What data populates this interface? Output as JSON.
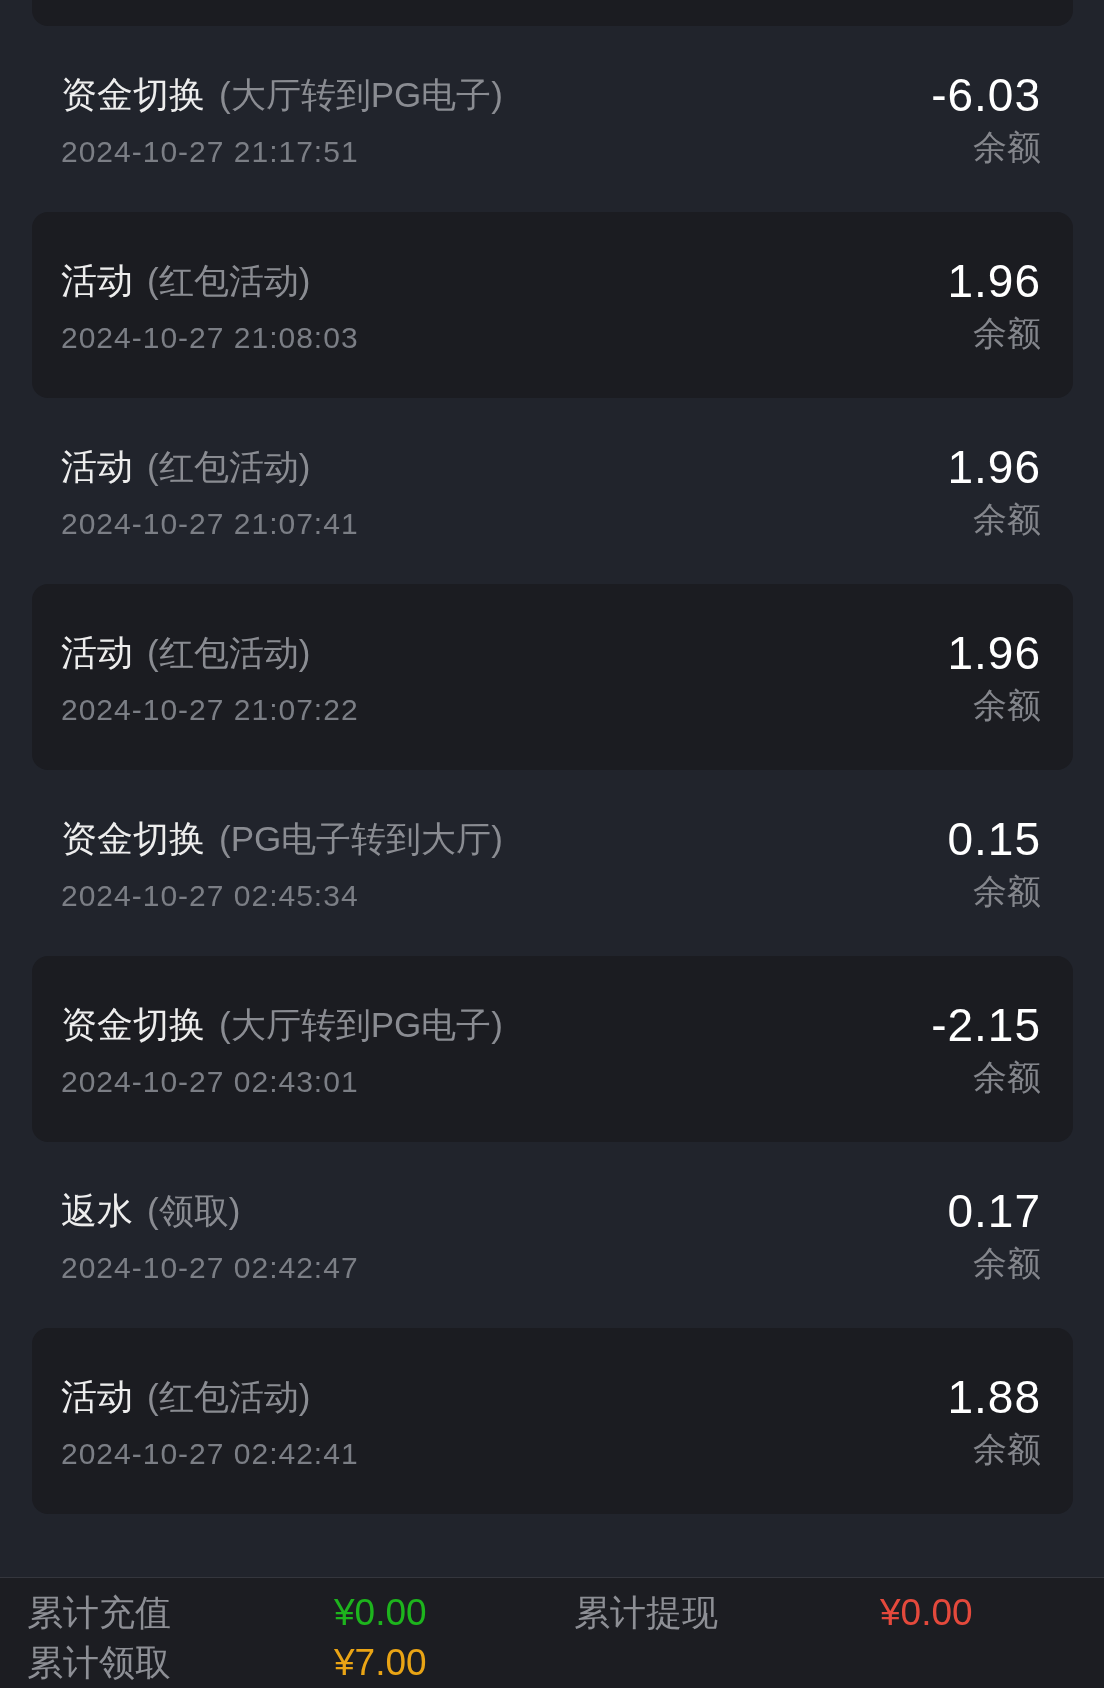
{
  "transactions": [
    {
      "type": "资金切换",
      "detail": "(大厅转到PG电子)",
      "time": "2024-10-27 21:17:51",
      "amount": "-6.03",
      "balance_label": "余额"
    },
    {
      "type": "活动",
      "detail": "(红包活动)",
      "time": "2024-10-27 21:08:03",
      "amount": "1.96",
      "balance_label": "余额"
    },
    {
      "type": "活动",
      "detail": "(红包活动)",
      "time": "2024-10-27 21:07:41",
      "amount": "1.96",
      "balance_label": "余额"
    },
    {
      "type": "活动",
      "detail": "(红包活动)",
      "time": "2024-10-27 21:07:22",
      "amount": "1.96",
      "balance_label": "余额"
    },
    {
      "type": "资金切换",
      "detail": "(PG电子转到大厅)",
      "time": "2024-10-27 02:45:34",
      "amount": "0.15",
      "balance_label": "余额"
    },
    {
      "type": "资金切换",
      "detail": "(大厅转到PG电子)",
      "time": "2024-10-27 02:43:01",
      "amount": "-2.15",
      "balance_label": "余额"
    },
    {
      "type": "返水",
      "detail": "(领取)",
      "time": "2024-10-27 02:42:47",
      "amount": "0.17",
      "balance_label": "余额"
    },
    {
      "type": "活动",
      "detail": "(红包活动)",
      "time": "2024-10-27 02:42:41",
      "amount": "1.88",
      "balance_label": "余额"
    }
  ],
  "summary": [
    {
      "label": "累计充值",
      "value": "¥0.00",
      "color": "#1db41d"
    },
    {
      "label": "累计提现",
      "value": "¥0.00",
      "color": "#e4493c"
    },
    {
      "label": "累计领取",
      "value": "¥7.00",
      "color": "#e9a415"
    }
  ]
}
